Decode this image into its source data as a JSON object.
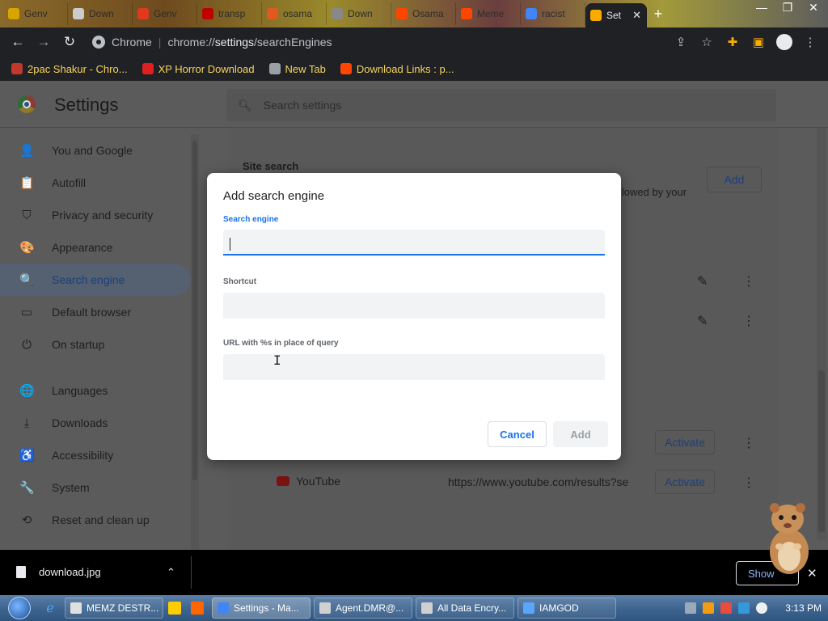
{
  "tabs": [
    {
      "label": "Genv",
      "icon": "puzzle-icon",
      "color": "#d9a400"
    },
    {
      "label": "Down",
      "icon": "image-icon",
      "color": "#cccccc"
    },
    {
      "label": "Genv",
      "icon": "fire-icon",
      "color": "#e03a1e"
    },
    {
      "label": "transp",
      "icon": "x-icon",
      "color": "#c00000"
    },
    {
      "label": "osama",
      "icon": "info-icon",
      "color": "#e05a1e"
    },
    {
      "label": "Down",
      "icon": "download-icon",
      "color": "#888888"
    },
    {
      "label": "Osama",
      "icon": "reddit-icon",
      "color": "#ff4500"
    },
    {
      "label": "Meme",
      "icon": "reddit-icon",
      "color": "#ff4500"
    },
    {
      "label": "racist",
      "icon": "google-icon",
      "color": "#4285f4"
    }
  ],
  "active_tab": {
    "label": "Set",
    "icon": "gear-icon",
    "color": "#f9ab00"
  },
  "toolbar": {
    "site_label": "Chrome",
    "url_prefix": "chrome://",
    "url_bold": "settings",
    "url_rest": "/searchEngines"
  },
  "bookmarks": [
    {
      "label": "2pac Shakur - Chro...",
      "color": "#c0392b"
    },
    {
      "label": "XP Horror Download",
      "color": "#e02020"
    },
    {
      "label": "New Tab",
      "color": "#9aa0a6"
    },
    {
      "label": "Download Links : p...",
      "color": "#ff4500"
    }
  ],
  "settings": {
    "title": "Settings",
    "search_placeholder": "Search settings",
    "nav": [
      {
        "label": "You and Google",
        "icon": "person-icon",
        "glyph": "👤"
      },
      {
        "label": "Autofill",
        "icon": "clipboard-icon",
        "glyph": "📋"
      },
      {
        "label": "Privacy and security",
        "icon": "shield-icon",
        "glyph": "⛉"
      },
      {
        "label": "Appearance",
        "icon": "palette-icon",
        "glyph": "🎨"
      },
      {
        "label": "Search engine",
        "icon": "search-icon",
        "glyph": "🔍",
        "active": true
      },
      {
        "label": "Default browser",
        "icon": "browser-icon",
        "glyph": "▭"
      },
      {
        "label": "On startup",
        "icon": "power-icon",
        "glyph": "⏻"
      }
    ],
    "nav_advanced": [
      {
        "label": "Languages",
        "icon": "globe-icon",
        "glyph": "🌐"
      },
      {
        "label": "Downloads",
        "icon": "download-icon",
        "glyph": "⤓"
      },
      {
        "label": "Accessibility",
        "icon": "accessibility-icon",
        "glyph": "♿"
      },
      {
        "label": "System",
        "icon": "wrench-icon",
        "glyph": "🔧"
      },
      {
        "label": "Reset and clean up",
        "icon": "history-icon",
        "glyph": "⟲"
      }
    ]
  },
  "content": {
    "site_search_title": "Site search",
    "add_label": "Add",
    "bg_text": "llowed by your",
    "activate_label": "Activate",
    "youtube_label": "YouTube",
    "youtube_url": "https://www.youtube.com/results?se"
  },
  "dialog": {
    "title": "Add search engine",
    "field1_label": "Search engine",
    "field1_value": "",
    "field2_label": "Shortcut",
    "field2_value": "",
    "field3_label": "URL with %s in place of query",
    "field3_value": "",
    "cancel_label": "Cancel",
    "add_label": "Add"
  },
  "download_bar": {
    "file_name": "download.jpg",
    "show_all_label": "Show"
  },
  "taskbar": {
    "items": [
      {
        "label": "MEMZ DESTR...",
        "color": "#e0e0e0"
      },
      {
        "label": "",
        "color": "#ffcc00"
      },
      {
        "label": "",
        "color": "#ff6600"
      },
      {
        "label": "Settings - Ma...",
        "color": "#4285f4",
        "active": true
      },
      {
        "label": "Agent.DMR@...",
        "color": "#d0d0d0"
      },
      {
        "label": "All Data Encry...",
        "color": "#d0d0d0"
      },
      {
        "label": "IAMGOD",
        "color": "#58a6ff"
      }
    ],
    "clock": "3:13 PM"
  }
}
